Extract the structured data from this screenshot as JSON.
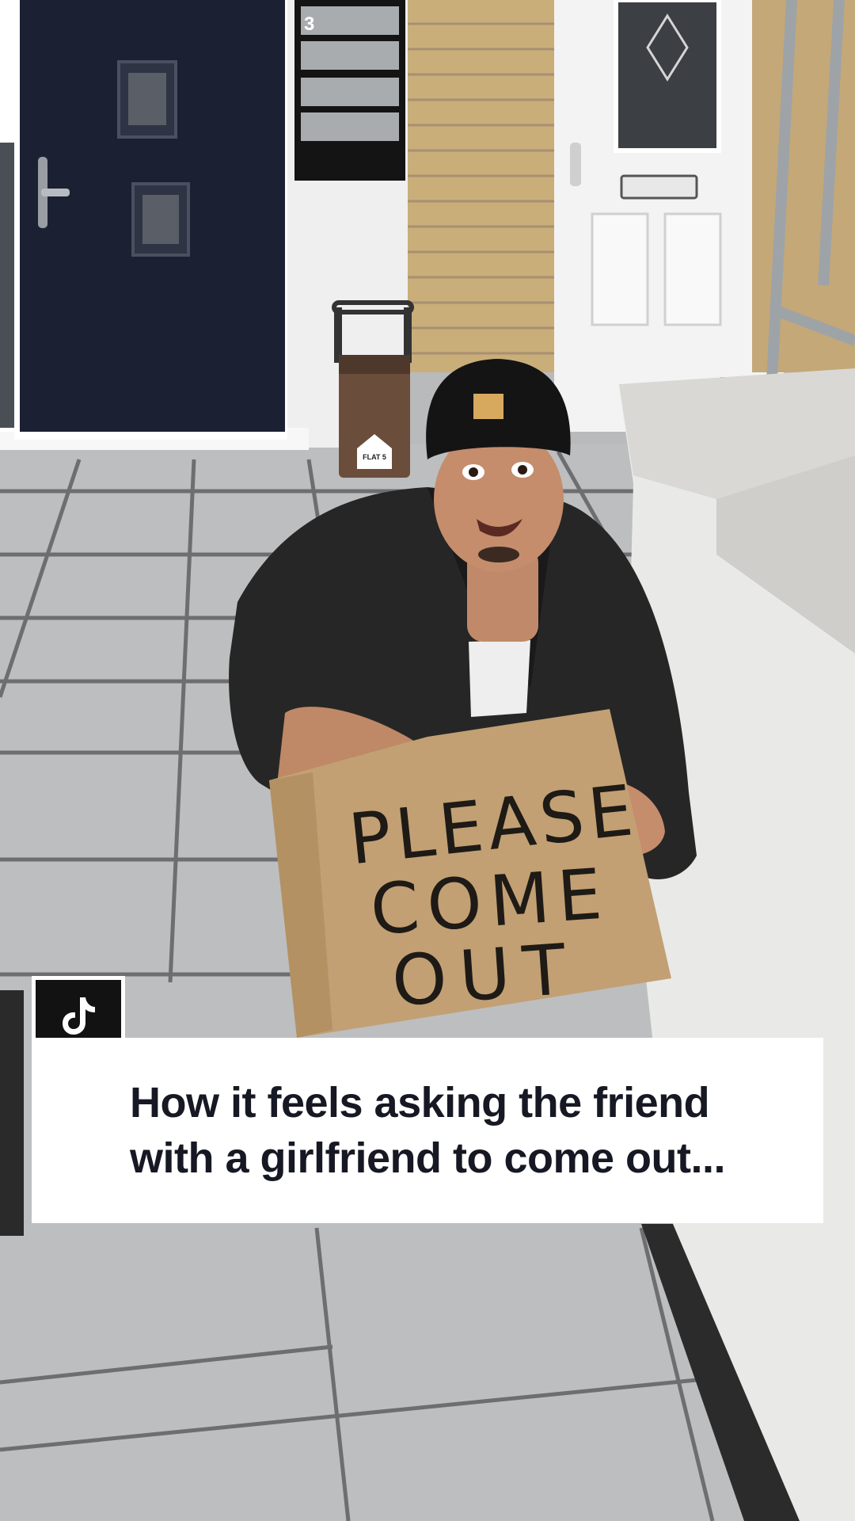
{
  "caption": {
    "text": "How it feels asking the friend\nwith a girlfriend to come out..."
  },
  "sign": {
    "line1": "PLEASE",
    "line2": "COME",
    "line3": "OUT"
  },
  "mailbox": {
    "number": "3"
  },
  "bin": {
    "label": "FLAT 5"
  },
  "badge": {
    "icon": "tiktok-logo-icon"
  }
}
